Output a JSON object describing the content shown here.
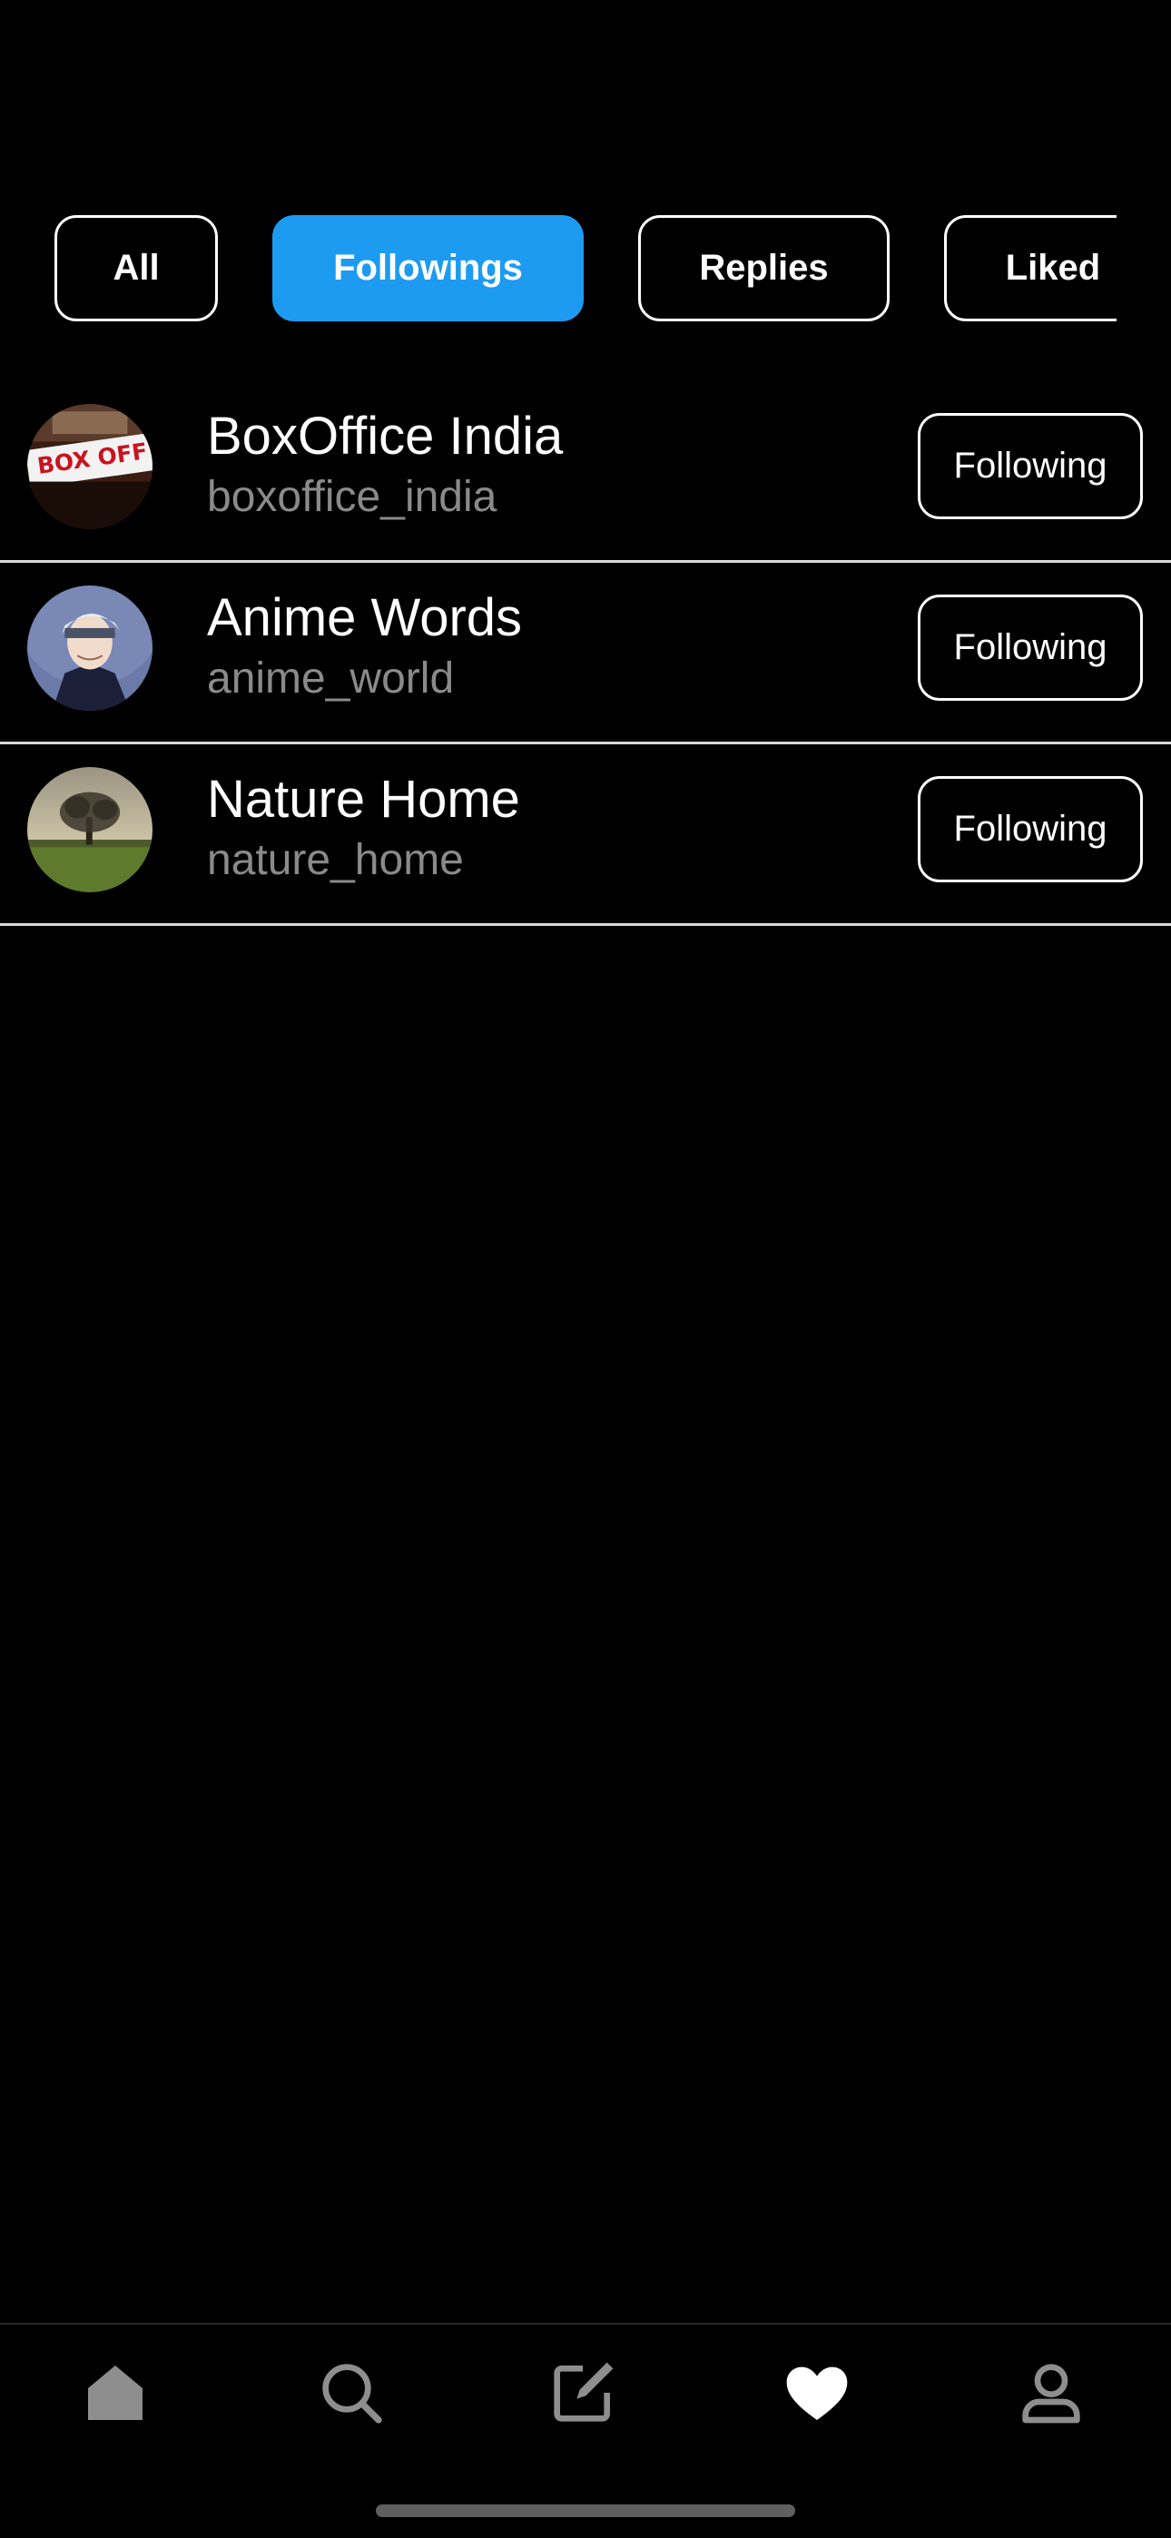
{
  "filter_tabs": [
    {
      "label": "All",
      "active": false
    },
    {
      "label": "Followings",
      "active": true
    },
    {
      "label": "Replies",
      "active": false
    },
    {
      "label": "Liked",
      "active": false
    }
  ],
  "accounts": [
    {
      "name": "BoxOffice India",
      "handle": "boxoffice_india",
      "button_label": "Following",
      "avatar": "box-office-marquee"
    },
    {
      "name": "Anime Words",
      "handle": "anime_world",
      "button_label": "Following",
      "avatar": "anime-character"
    },
    {
      "name": "Nature Home",
      "handle": "nature_home",
      "button_label": "Following",
      "avatar": "lone-tree-landscape"
    }
  ],
  "bottom_nav": [
    {
      "icon": "home-icon",
      "active": false
    },
    {
      "icon": "search-icon",
      "active": false
    },
    {
      "icon": "compose-icon",
      "active": false
    },
    {
      "icon": "heart-icon",
      "active": true
    },
    {
      "icon": "profile-icon",
      "active": false
    }
  ],
  "colors": {
    "background": "#000000",
    "accent": "#1d9bf0",
    "secondary_text": "#8a8a8a",
    "inactive_icon": "#8e8e8e"
  }
}
